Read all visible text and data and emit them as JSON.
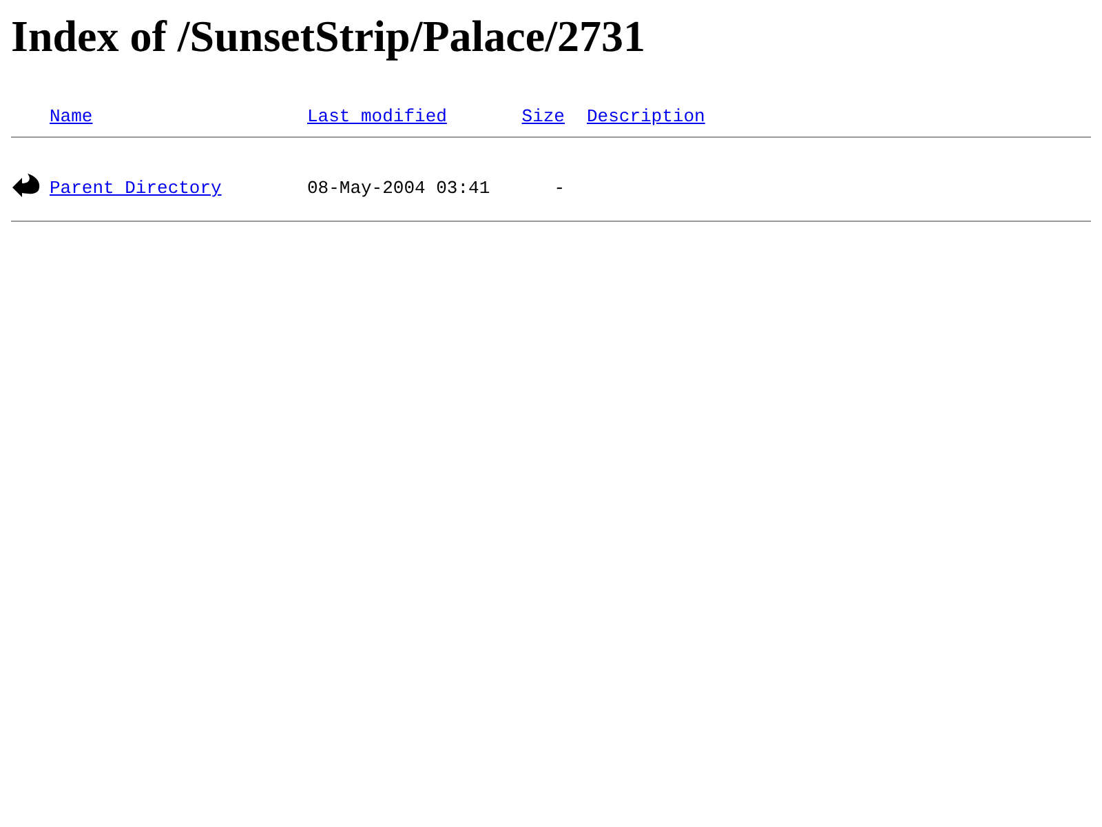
{
  "title": "Index of /SunsetStrip/Palace/2731",
  "columns": [
    "Name",
    "Last modified",
    "Size",
    "Description"
  ],
  "rows": [
    {
      "name": "Parent Directory",
      "last_modified": "08-May-2004 03:41",
      "size": "-"
    }
  ]
}
